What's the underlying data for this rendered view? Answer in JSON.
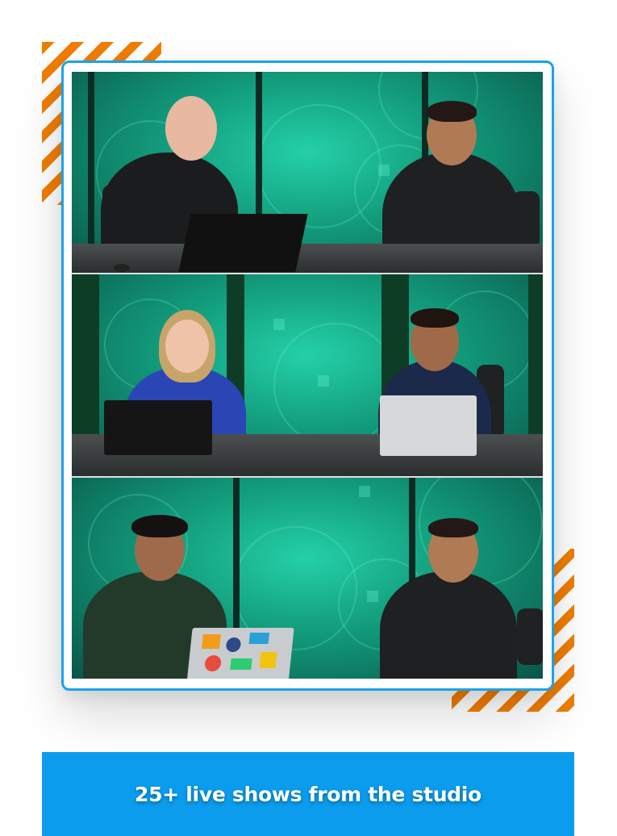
{
  "images": [
    {
      "alt": "Two hosts talking at a studio desk, one with a laptop"
    },
    {
      "alt": "Woman and man talking at a studio desk with laptops"
    },
    {
      "alt": "Man with sticker-covered laptop talking to a host"
    }
  ],
  "caption": "25+ live shows from the studio",
  "colors": {
    "accent": "#0b9ced",
    "stripe": "#f07d00",
    "frame": "#1aa3e8"
  }
}
